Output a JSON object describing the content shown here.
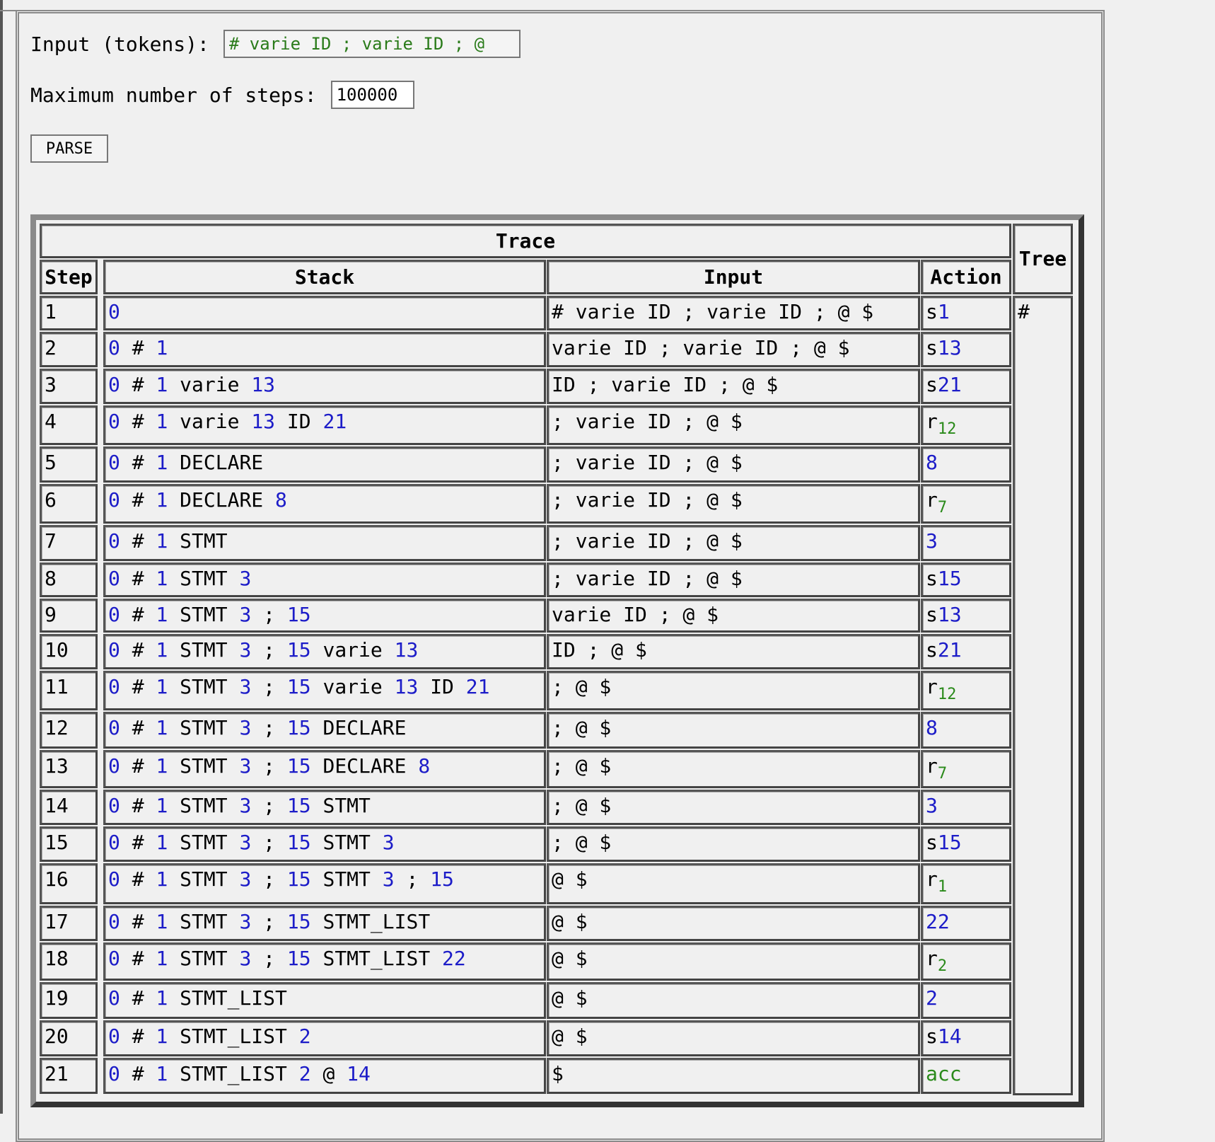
{
  "form": {
    "input_label": "Input (tokens):",
    "input_value": "# varie ID ; varie ID ; @",
    "steps_label": "Maximum number of steps:",
    "steps_value": "100000",
    "parse_label": "PARSE"
  },
  "table": {
    "trace_title": "Trace",
    "tree_title": "Tree",
    "col_step": "Step",
    "col_stack": "Stack",
    "col_input": "Input",
    "col_action": "Action",
    "tree_value": "#",
    "rows": [
      {
        "step": "1",
        "stack": [
          [
            "0",
            "n"
          ]
        ],
        "input": "# varie ID ; varie ID ; @ $",
        "action": [
          [
            "s",
            "t"
          ],
          [
            "1",
            "n"
          ]
        ]
      },
      {
        "step": "2",
        "stack": [
          [
            "0",
            "n"
          ],
          [
            "#",
            "t"
          ],
          [
            "1",
            "n"
          ]
        ],
        "input": "varie ID ; varie ID ; @ $",
        "action": [
          [
            "s",
            "t"
          ],
          [
            "13",
            "n"
          ]
        ]
      },
      {
        "step": "3",
        "stack": [
          [
            "0",
            "n"
          ],
          [
            "#",
            "t"
          ],
          [
            "1",
            "n"
          ],
          [
            "varie",
            "t"
          ],
          [
            "13",
            "n"
          ]
        ],
        "input": "ID ; varie ID ; @ $",
        "action": [
          [
            "s",
            "t"
          ],
          [
            "21",
            "n"
          ]
        ]
      },
      {
        "step": "4",
        "stack": [
          [
            "0",
            "n"
          ],
          [
            "#",
            "t"
          ],
          [
            "1",
            "n"
          ],
          [
            "varie",
            "t"
          ],
          [
            "13",
            "n"
          ],
          [
            "ID",
            "t"
          ],
          [
            "21",
            "n"
          ]
        ],
        "input": "; varie ID ; @ $",
        "action": [
          [
            "r",
            "t"
          ],
          [
            "12",
            "s"
          ]
        ]
      },
      {
        "step": "5",
        "stack": [
          [
            "0",
            "n"
          ],
          [
            "#",
            "t"
          ],
          [
            "1",
            "n"
          ],
          [
            "DECLARE",
            "t"
          ]
        ],
        "input": "; varie ID ; @ $",
        "action": [
          [
            "8",
            "n"
          ]
        ]
      },
      {
        "step": "6",
        "stack": [
          [
            "0",
            "n"
          ],
          [
            "#",
            "t"
          ],
          [
            "1",
            "n"
          ],
          [
            "DECLARE",
            "t"
          ],
          [
            "8",
            "n"
          ]
        ],
        "input": "; varie ID ; @ $",
        "action": [
          [
            "r",
            "t"
          ],
          [
            "7",
            "s"
          ]
        ]
      },
      {
        "step": "7",
        "stack": [
          [
            "0",
            "n"
          ],
          [
            "#",
            "t"
          ],
          [
            "1",
            "n"
          ],
          [
            "STMT",
            "t"
          ]
        ],
        "input": "; varie ID ; @ $",
        "action": [
          [
            "3",
            "n"
          ]
        ]
      },
      {
        "step": "8",
        "stack": [
          [
            "0",
            "n"
          ],
          [
            "#",
            "t"
          ],
          [
            "1",
            "n"
          ],
          [
            "STMT",
            "t"
          ],
          [
            "3",
            "n"
          ]
        ],
        "input": "; varie ID ; @ $",
        "action": [
          [
            "s",
            "t"
          ],
          [
            "15",
            "n"
          ]
        ]
      },
      {
        "step": "9",
        "stack": [
          [
            "0",
            "n"
          ],
          [
            "#",
            "t"
          ],
          [
            "1",
            "n"
          ],
          [
            "STMT",
            "t"
          ],
          [
            "3",
            "n"
          ],
          [
            ";",
            "t"
          ],
          [
            "15",
            "n"
          ]
        ],
        "input": "varie ID ; @ $",
        "action": [
          [
            "s",
            "t"
          ],
          [
            "13",
            "n"
          ]
        ]
      },
      {
        "step": "10",
        "stack": [
          [
            "0",
            "n"
          ],
          [
            "#",
            "t"
          ],
          [
            "1",
            "n"
          ],
          [
            "STMT",
            "t"
          ],
          [
            "3",
            "n"
          ],
          [
            ";",
            "t"
          ],
          [
            "15",
            "n"
          ],
          [
            "varie",
            "t"
          ],
          [
            "13",
            "n"
          ]
        ],
        "input": "ID ; @ $",
        "action": [
          [
            "s",
            "t"
          ],
          [
            "21",
            "n"
          ]
        ]
      },
      {
        "step": "11",
        "stack": [
          [
            "0",
            "n"
          ],
          [
            "#",
            "t"
          ],
          [
            "1",
            "n"
          ],
          [
            "STMT",
            "t"
          ],
          [
            "3",
            "n"
          ],
          [
            ";",
            "t"
          ],
          [
            "15",
            "n"
          ],
          [
            "varie",
            "t"
          ],
          [
            "13",
            "n"
          ],
          [
            "ID",
            "t"
          ],
          [
            "21",
            "n"
          ]
        ],
        "input": "; @ $",
        "action": [
          [
            "r",
            "t"
          ],
          [
            "12",
            "s"
          ]
        ]
      },
      {
        "step": "12",
        "stack": [
          [
            "0",
            "n"
          ],
          [
            "#",
            "t"
          ],
          [
            "1",
            "n"
          ],
          [
            "STMT",
            "t"
          ],
          [
            "3",
            "n"
          ],
          [
            ";",
            "t"
          ],
          [
            "15",
            "n"
          ],
          [
            "DECLARE",
            "t"
          ]
        ],
        "input": "; @ $",
        "action": [
          [
            "8",
            "n"
          ]
        ]
      },
      {
        "step": "13",
        "stack": [
          [
            "0",
            "n"
          ],
          [
            "#",
            "t"
          ],
          [
            "1",
            "n"
          ],
          [
            "STMT",
            "t"
          ],
          [
            "3",
            "n"
          ],
          [
            ";",
            "t"
          ],
          [
            "15",
            "n"
          ],
          [
            "DECLARE",
            "t"
          ],
          [
            "8",
            "n"
          ]
        ],
        "input": "; @ $",
        "action": [
          [
            "r",
            "t"
          ],
          [
            "7",
            "s"
          ]
        ]
      },
      {
        "step": "14",
        "stack": [
          [
            "0",
            "n"
          ],
          [
            "#",
            "t"
          ],
          [
            "1",
            "n"
          ],
          [
            "STMT",
            "t"
          ],
          [
            "3",
            "n"
          ],
          [
            ";",
            "t"
          ],
          [
            "15",
            "n"
          ],
          [
            "STMT",
            "t"
          ]
        ],
        "input": "; @ $",
        "action": [
          [
            "3",
            "n"
          ]
        ]
      },
      {
        "step": "15",
        "stack": [
          [
            "0",
            "n"
          ],
          [
            "#",
            "t"
          ],
          [
            "1",
            "n"
          ],
          [
            "STMT",
            "t"
          ],
          [
            "3",
            "n"
          ],
          [
            ";",
            "t"
          ],
          [
            "15",
            "n"
          ],
          [
            "STMT",
            "t"
          ],
          [
            "3",
            "n"
          ]
        ],
        "input": "; @ $",
        "action": [
          [
            "s",
            "t"
          ],
          [
            "15",
            "n"
          ]
        ]
      },
      {
        "step": "16",
        "stack": [
          [
            "0",
            "n"
          ],
          [
            "#",
            "t"
          ],
          [
            "1",
            "n"
          ],
          [
            "STMT",
            "t"
          ],
          [
            "3",
            "n"
          ],
          [
            ";",
            "t"
          ],
          [
            "15",
            "n"
          ],
          [
            "STMT",
            "t"
          ],
          [
            "3",
            "n"
          ],
          [
            ";",
            "t"
          ],
          [
            "15",
            "n"
          ]
        ],
        "input": "@ $",
        "action": [
          [
            "r",
            "t"
          ],
          [
            "1",
            "s"
          ]
        ]
      },
      {
        "step": "17",
        "stack": [
          [
            "0",
            "n"
          ],
          [
            "#",
            "t"
          ],
          [
            "1",
            "n"
          ],
          [
            "STMT",
            "t"
          ],
          [
            "3",
            "n"
          ],
          [
            ";",
            "t"
          ],
          [
            "15",
            "n"
          ],
          [
            "STMT_LIST",
            "t"
          ]
        ],
        "input": "@ $",
        "action": [
          [
            "22",
            "n"
          ]
        ]
      },
      {
        "step": "18",
        "stack": [
          [
            "0",
            "n"
          ],
          [
            "#",
            "t"
          ],
          [
            "1",
            "n"
          ],
          [
            "STMT",
            "t"
          ],
          [
            "3",
            "n"
          ],
          [
            ";",
            "t"
          ],
          [
            "15",
            "n"
          ],
          [
            "STMT_LIST",
            "t"
          ],
          [
            "22",
            "n"
          ]
        ],
        "input": "@ $",
        "action": [
          [
            "r",
            "t"
          ],
          [
            "2",
            "s"
          ]
        ]
      },
      {
        "step": "19",
        "stack": [
          [
            "0",
            "n"
          ],
          [
            "#",
            "t"
          ],
          [
            "1",
            "n"
          ],
          [
            "STMT_LIST",
            "t"
          ]
        ],
        "input": "@ $",
        "action": [
          [
            "2",
            "n"
          ]
        ]
      },
      {
        "step": "20",
        "stack": [
          [
            "0",
            "n"
          ],
          [
            "#",
            "t"
          ],
          [
            "1",
            "n"
          ],
          [
            "STMT_LIST",
            "t"
          ],
          [
            "2",
            "n"
          ]
        ],
        "input": "@ $",
        "action": [
          [
            "s",
            "t"
          ],
          [
            "14",
            "n"
          ]
        ]
      },
      {
        "step": "21",
        "stack": [
          [
            "0",
            "n"
          ],
          [
            "#",
            "t"
          ],
          [
            "1",
            "n"
          ],
          [
            "STMT_LIST",
            "t"
          ],
          [
            "2",
            "n"
          ],
          [
            "@",
            "t"
          ],
          [
            "14",
            "n"
          ]
        ],
        "input": "$",
        "action": [
          [
            "acc",
            "a"
          ]
        ]
      }
    ]
  },
  "colors": {
    "state_number": "#1c1cc8",
    "rule_number": "#2a8a1a",
    "accept": "#2a8a1a",
    "token_input_text": "#2a7b1a"
  }
}
